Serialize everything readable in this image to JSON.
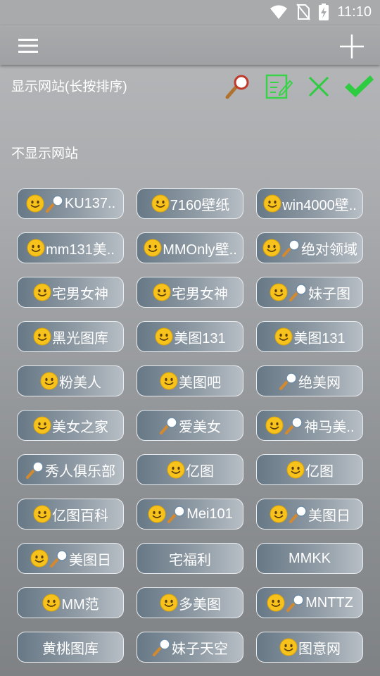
{
  "status_bar": {
    "time": "11:10",
    "icons": [
      "wifi-icon",
      "no-sim-icon",
      "battery-charging-icon"
    ]
  },
  "app_bar": {
    "menu_icon": "hamburger-menu-icon",
    "add_icon": "plus-icon"
  },
  "shown_section": {
    "title": "显示网站(长按排序)",
    "actions": [
      "search-icon",
      "edit-icon",
      "close-icon",
      "check-icon"
    ]
  },
  "hidden_section": {
    "title": "不显示网站",
    "sites": [
      {
        "label": "KU137..",
        "smiley": true,
        "search": true
      },
      {
        "label": "7160壁纸",
        "smiley": true,
        "search": false
      },
      {
        "label": "win4000壁..",
        "smiley": true,
        "search": false
      },
      {
        "label": "mm131美..",
        "smiley": true,
        "search": false
      },
      {
        "label": "MMOnly壁..",
        "smiley": true,
        "search": false
      },
      {
        "label": "绝对领域",
        "smiley": true,
        "search": true
      },
      {
        "label": "宅男女神",
        "smiley": true,
        "search": false
      },
      {
        "label": "宅男女神",
        "smiley": true,
        "search": false
      },
      {
        "label": "妹子图",
        "smiley": true,
        "search": true
      },
      {
        "label": "黑光图库",
        "smiley": true,
        "search": false
      },
      {
        "label": "美图131",
        "smiley": true,
        "search": false
      },
      {
        "label": "美图131",
        "smiley": true,
        "search": false
      },
      {
        "label": "粉美人",
        "smiley": true,
        "search": false
      },
      {
        "label": "美图吧",
        "smiley": true,
        "search": false
      },
      {
        "label": "绝美网",
        "smiley": false,
        "search": true
      },
      {
        "label": "美女之家",
        "smiley": true,
        "search": false
      },
      {
        "label": "爱美女",
        "smiley": false,
        "search": true
      },
      {
        "label": "神马美..",
        "smiley": true,
        "search": true
      },
      {
        "label": "秀人俱乐部",
        "smiley": false,
        "search": true
      },
      {
        "label": "亿图",
        "smiley": true,
        "search": false
      },
      {
        "label": "亿图",
        "smiley": true,
        "search": false
      },
      {
        "label": "亿图百科",
        "smiley": true,
        "search": false
      },
      {
        "label": "Mei101",
        "smiley": true,
        "search": true
      },
      {
        "label": "美图日",
        "smiley": true,
        "search": true
      },
      {
        "label": "美图日",
        "smiley": true,
        "search": true
      },
      {
        "label": "宅福利",
        "smiley": false,
        "search": false
      },
      {
        "label": "MMKK",
        "smiley": false,
        "search": false
      },
      {
        "label": "MM范",
        "smiley": true,
        "search": false
      },
      {
        "label": "多美图",
        "smiley": true,
        "search": false
      },
      {
        "label": "MNTTZ",
        "smiley": true,
        "search": true
      },
      {
        "label": "黄桃图库",
        "smiley": false,
        "search": false
      },
      {
        "label": "妹子天空",
        "smiley": false,
        "search": true
      },
      {
        "label": "图意网",
        "smiley": true,
        "search": false
      }
    ]
  }
}
